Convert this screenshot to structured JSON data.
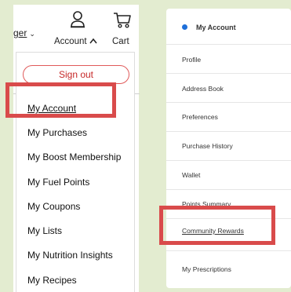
{
  "header": {
    "manager_label": "ger",
    "account_label": "Account",
    "cart_label": "Cart"
  },
  "dropdown": {
    "signout_label": "Sign out",
    "items": [
      {
        "label": "My Account"
      },
      {
        "label": "My Purchases"
      },
      {
        "label": "My Boost Membership"
      },
      {
        "label": "My Fuel Points"
      },
      {
        "label": "My Coupons"
      },
      {
        "label": "My Lists"
      },
      {
        "label": "My Nutrition Insights"
      },
      {
        "label": "My Recipes"
      }
    ]
  },
  "account_menu": {
    "title": "My Account",
    "items": [
      {
        "label": "Profile"
      },
      {
        "label": "Address Book"
      },
      {
        "label": "Preferences"
      },
      {
        "label": "Purchase History"
      },
      {
        "label": "Wallet"
      },
      {
        "label": "Points Summary"
      },
      {
        "label": "Community Rewards"
      },
      {
        "label": "My Prescriptions"
      }
    ]
  },
  "colors": {
    "highlight": "#d94b4b",
    "signout": "#c62828",
    "accent_dot": "#1e6fd9",
    "background": "#e3ecd0"
  }
}
